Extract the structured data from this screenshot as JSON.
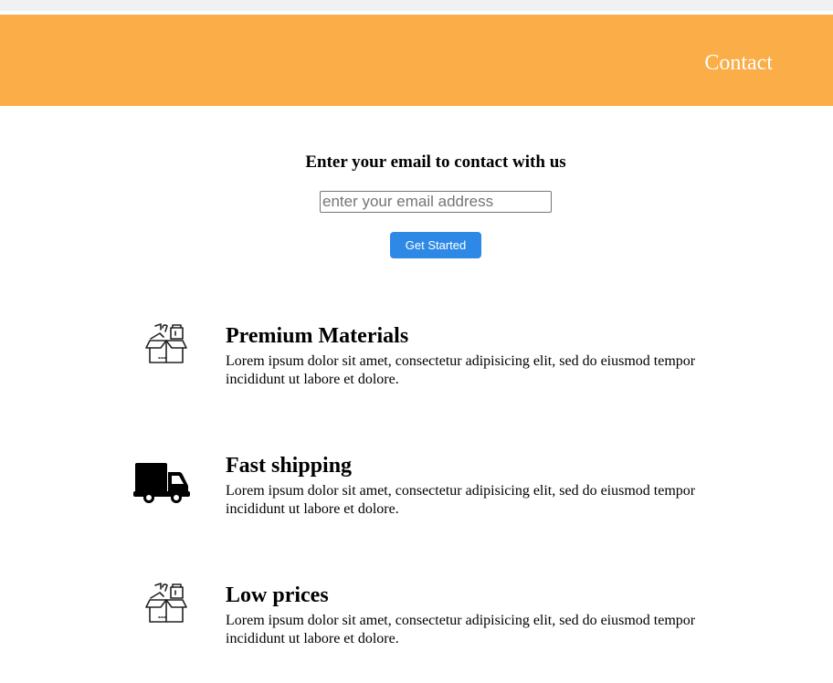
{
  "header": {
    "background": "#fbad48",
    "nav_contact": "Contact"
  },
  "signup": {
    "heading": "Enter your email to contact with us",
    "email_placeholder": "enter your email address",
    "email_value": "",
    "button_label": "Get Started",
    "button_color": "#2e89e6"
  },
  "features": [
    {
      "icon": "box-with-tools-icon",
      "title": "Premium Materials",
      "text": "Lorem ipsum dolor sit amet, consectetur adipisicing elit, sed do eiusmod tempor incididunt ut labore et dolore."
    },
    {
      "icon": "delivery-truck-icon",
      "title": "Fast shipping",
      "text": "Lorem ipsum dolor sit amet, consectetur adipisicing elit, sed do eiusmod tempor incididunt ut labore et dolore."
    },
    {
      "icon": "box-with-tools-icon",
      "title": "Low prices",
      "text": "Lorem ipsum dolor sit amet, consectetur adipisicing elit, sed do eiusmod tempor incididunt ut labore et dolore."
    }
  ]
}
